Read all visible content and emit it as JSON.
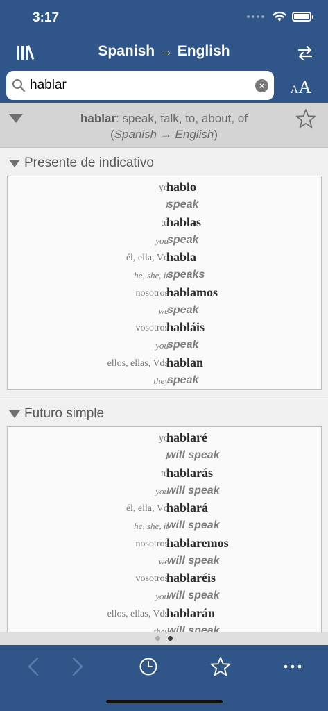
{
  "status": {
    "time": "3:17"
  },
  "nav": {
    "title": "Spanish → English"
  },
  "search": {
    "value": "hablar",
    "placeholder": ""
  },
  "entry": {
    "word": "hablar",
    "definition": ": speak, talk, to, about, of",
    "lang": "Spanish → English"
  },
  "sections": [
    {
      "title": "Presente de indicativo",
      "rows": [
        {
          "pronoun": "yo",
          "form": "hablo",
          "pron_en": "I",
          "trans": "speak"
        },
        {
          "pronoun": "tú",
          "form": "hablas",
          "pron_en": "you",
          "trans": "speak"
        },
        {
          "pronoun": "él, ella, Vd",
          "form": "habla",
          "pron_en": "he, she, it",
          "trans": "speaks"
        },
        {
          "pronoun": "nosotros",
          "form": "hablamos",
          "pron_en": "we",
          "trans": "speak"
        },
        {
          "pronoun": "vosotros",
          "form": "habláis",
          "pron_en": "you",
          "trans": "speak"
        },
        {
          "pronoun": "ellos, ellas, Vds",
          "form": "hablan",
          "pron_en": "they",
          "trans": "speak"
        }
      ]
    },
    {
      "title": "Futuro simple",
      "rows": [
        {
          "pronoun": "yo",
          "form": "hablaré",
          "pron_en": "I",
          "trans": "will speak"
        },
        {
          "pronoun": "tú",
          "form": "hablarás",
          "pron_en": "you",
          "trans": "will speak"
        },
        {
          "pronoun": "él, ella, Vd",
          "form": "hablará",
          "pron_en": "he, she, it",
          "trans": "will speak"
        },
        {
          "pronoun": "nosotros",
          "form": "hablaremos",
          "pron_en": "we",
          "trans": "will speak"
        },
        {
          "pronoun": "vosotros",
          "form": "hablaréis",
          "pron_en": "you",
          "trans": "will speak"
        },
        {
          "pronoun": "ellos, ellas, Vds",
          "form": "hablarán",
          "pron_en": "they",
          "trans": "will speak"
        }
      ]
    }
  ],
  "pager": {
    "pages": 2,
    "current": 2
  },
  "toolbar": {
    "icons": [
      "back-arrow-icon",
      "forward-arrow-icon",
      "history-clock-icon",
      "favorites-star-icon",
      "more-dots-icon"
    ]
  },
  "colors": {
    "nav_bg": "#2f5589",
    "accent": "#ffffff"
  }
}
